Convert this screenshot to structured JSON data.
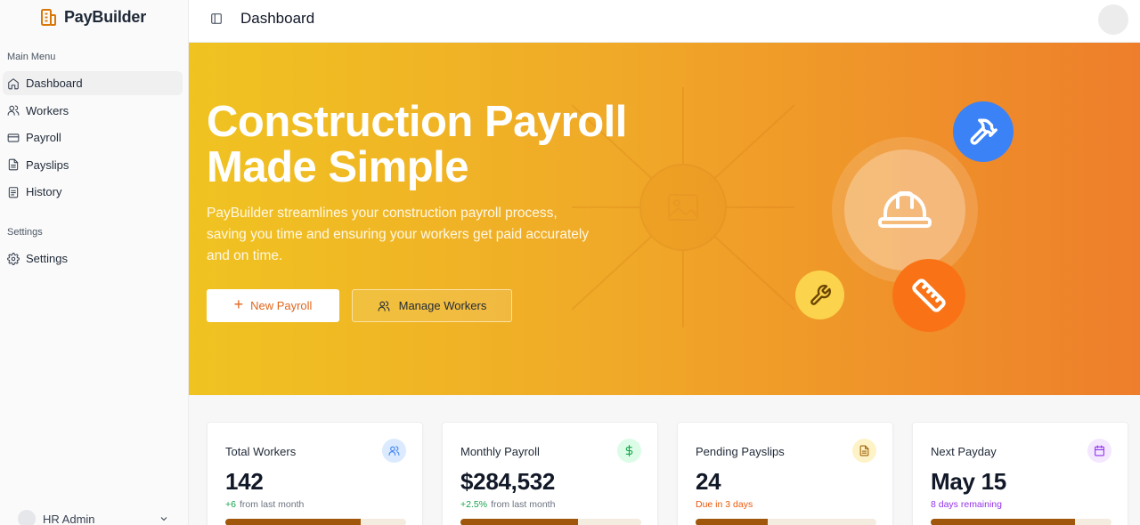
{
  "brand": {
    "name": "PayBuilder",
    "logo_icon": "building-icon",
    "accent": "#d97706"
  },
  "sidebar": {
    "main_menu_label": "Main Menu",
    "items": [
      {
        "label": "Dashboard",
        "icon": "home-icon",
        "active": true
      },
      {
        "label": "Workers",
        "icon": "users-icon",
        "active": false
      },
      {
        "label": "Payroll",
        "icon": "credit-card-icon",
        "active": false
      },
      {
        "label": "Payslips",
        "icon": "file-text-icon",
        "active": false
      },
      {
        "label": "History",
        "icon": "clipboard-list-icon",
        "active": false
      }
    ],
    "settings_label": "Settings",
    "settings_items": [
      {
        "label": "Settings",
        "icon": "gear-icon"
      }
    ],
    "user": {
      "name": "HR Admin"
    }
  },
  "header": {
    "title": "Dashboard"
  },
  "hero": {
    "title": "Construction Payroll Made Simple",
    "subtitle": "PayBuilder streamlines your construction payroll process, saving you time and ensuring your workers get paid accurately and on time.",
    "primary_button": "New Payroll",
    "secondary_button": "Manage Workers",
    "gradient": [
      "#f0c321",
      "#ee7e2b"
    ]
  },
  "stats": [
    {
      "title": "Total Workers",
      "value": "142",
      "delta": "+6",
      "note": "from last month",
      "progress": 0.75,
      "icon": "users-icon",
      "icon_bg": "#dbeafe",
      "icon_color": "#3b82f6",
      "sub_color": "#16a34a"
    },
    {
      "title": "Monthly Payroll",
      "value": "$284,532",
      "delta": "+2.5%",
      "note": "from last month",
      "progress": 0.65,
      "icon": "dollar-icon",
      "icon_bg": "#dcfce7",
      "icon_color": "#16a34a",
      "sub_color": "#16a34a"
    },
    {
      "title": "Pending Payslips",
      "value": "24",
      "delta": "",
      "note": "Due in 3 days",
      "progress": 0.4,
      "icon": "file-icon",
      "icon_bg": "#fef3c7",
      "icon_color": "#a16207",
      "sub_color": "#ea580c"
    },
    {
      "title": "Next Payday",
      "value": "May 15",
      "delta": "",
      "note": "8 days remaining",
      "progress": 0.8,
      "icon": "calendar-icon",
      "icon_bg": "#f3e8ff",
      "icon_color": "#9333ea",
      "sub_color": "#9333ea"
    }
  ]
}
